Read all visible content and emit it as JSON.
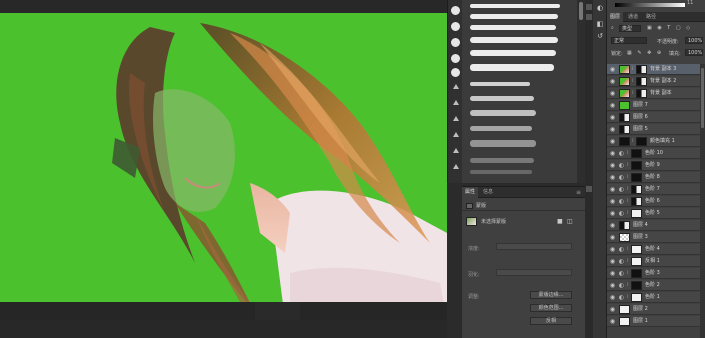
{
  "colors": {
    "canvas_green": "#4cc12e",
    "panel_bg": "#404040",
    "selected_layer": "#58606b"
  },
  "gradient": {
    "value": "11"
  },
  "layers_panel": {
    "tabs": [
      "图层",
      "通道",
      "路径"
    ],
    "kind_label": "类型",
    "blend_mode": "正常",
    "opacity_label": "不透明度:",
    "opacity_value": "100%",
    "lock_label": "锁定:",
    "fill_label": "填充:",
    "fill_value": "100%",
    "layers": [
      {
        "name": "背景 副本 3",
        "thumb": "photo",
        "mask": "bw",
        "selected": true
      },
      {
        "name": "背景 副本 2",
        "thumb": "photo",
        "mask": "bw",
        "selected": false
      },
      {
        "name": "背景 副本",
        "thumb": "photo",
        "mask": "bw",
        "selected": false
      },
      {
        "name": "图层 7",
        "thumb": "green",
        "mask": "",
        "selected": false
      },
      {
        "name": "图层 6",
        "thumb": "bw",
        "mask": "",
        "selected": false
      },
      {
        "name": "图层 5",
        "thumb": "bw",
        "mask": "",
        "selected": false
      },
      {
        "name": "颜色填充 1",
        "thumb": "black",
        "mask": "black",
        "selected": false
      },
      {
        "name": "色阶 10",
        "thumb": "adj",
        "mask": "black",
        "selected": false
      },
      {
        "name": "色阶 9",
        "thumb": "adj",
        "mask": "black",
        "selected": false
      },
      {
        "name": "色阶 8",
        "thumb": "adj",
        "mask": "black",
        "selected": false
      },
      {
        "name": "色阶 7",
        "thumb": "adj",
        "mask": "bw",
        "selected": false
      },
      {
        "name": "色阶 6",
        "thumb": "adj",
        "mask": "bw",
        "selected": false
      },
      {
        "name": "色阶 5",
        "thumb": "adj",
        "mask": "white",
        "selected": false
      },
      {
        "name": "图层 4",
        "thumb": "bw",
        "mask": "",
        "selected": false
      },
      {
        "name": "图层 3",
        "thumb": "checker",
        "mask": "",
        "selected": false
      },
      {
        "name": "色阶 4",
        "thumb": "adj",
        "mask": "white",
        "selected": false
      },
      {
        "name": "反相 1",
        "thumb": "adj",
        "mask": "white",
        "selected": false
      },
      {
        "name": "色阶 3",
        "thumb": "adj",
        "mask": "black",
        "selected": false
      },
      {
        "name": "色阶 2",
        "thumb": "adj",
        "mask": "black",
        "selected": false
      },
      {
        "name": "色阶 1",
        "thumb": "adj",
        "mask": "white",
        "selected": false
      },
      {
        "name": "图层 2",
        "thumb": "white",
        "mask": "",
        "selected": false
      },
      {
        "name": "图层 1",
        "thumb": "white",
        "mask": "",
        "selected": false
      }
    ]
  },
  "properties_panel": {
    "tabs": [
      "属性",
      "信息"
    ],
    "header": "蒙版",
    "selection_label": "未选择蒙版",
    "density_label": "浓度:",
    "feather_label": "羽化:",
    "refine_label": "调整:",
    "buttons": [
      "蒙版边缘...",
      "颜色范围...",
      "反相"
    ]
  }
}
